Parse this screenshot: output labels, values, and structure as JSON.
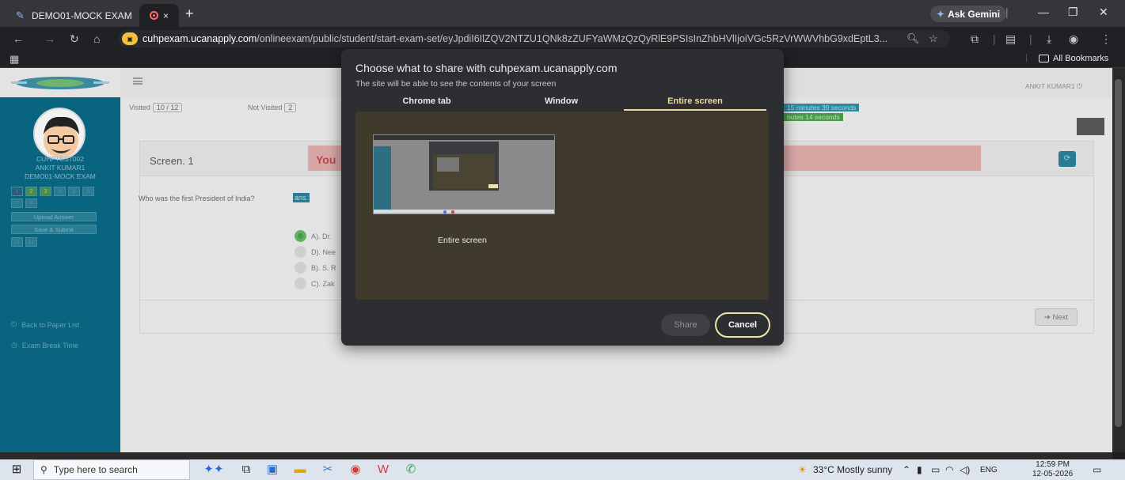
{
  "browser": {
    "tab_title": "DEMO01-MOCK EXAM",
    "rec_tab_close": "×",
    "new_tab": "+",
    "ask_gemini": "Ask Gemini",
    "url_domain": "cuhpexam.ucanapply.com",
    "url_path": "/onlineexam/public/student/start-exam-set/eyJpdiI6IlZQV2NTZU1QNk8zZUFYaWMzQzQyRlE9PSIsInZhbHVlIjoiVGc5RzVrWWVhbG9xdEptL3...",
    "all_bookmarks": "All Bookmarks"
  },
  "exam_page": {
    "username": "ANKIT KUMAR1",
    "sidebar": {
      "user_id": "CUHPTEST002",
      "user_name": "ANKIT KUMAR1",
      "exam_name": "DEMO01-MOCK EXAM",
      "questions": [
        "1",
        "2",
        "3",
        "4",
        "5",
        "6",
        "7",
        "8"
      ],
      "upload_answer": "Upload Answer",
      "save_submit": "Save & Submit",
      "extra_questions": [
        "11",
        "12"
      ],
      "back_to_paper": "Back to Paper List",
      "exam_break": "Exam Break Time"
    },
    "stats": {
      "visited_label": "Visited",
      "visited_value": "10 / 12",
      "not_visited_label": "Not Visited",
      "not_visited_value": "2",
      "timer_total": "15 minutes 39 seconds",
      "timer_remaining": "nutes 14 seconds"
    },
    "screen_title": "Screen. 1",
    "warning_text": "You",
    "question": "Who was the first President of India?",
    "ans_label": "ans.",
    "options": [
      "A). Dr.",
      "D). Nee",
      "B). S. R",
      "C). Zak"
    ],
    "next": "Next"
  },
  "share_dialog": {
    "title": "Choose what to share with cuhpexam.ucanapply.com",
    "subtitle": "The site will be able to see the contents of your screen",
    "tabs": [
      "Chrome tab",
      "Window",
      "Entire screen"
    ],
    "preview_label": "Entire screen",
    "share": "Share",
    "cancel": "Cancel"
  },
  "taskbar": {
    "search_placeholder": "Type here to search",
    "weather": "33°C  Mostly sunny",
    "lang": "ENG",
    "time": "12:59 PM",
    "date": "12-05-2026"
  }
}
